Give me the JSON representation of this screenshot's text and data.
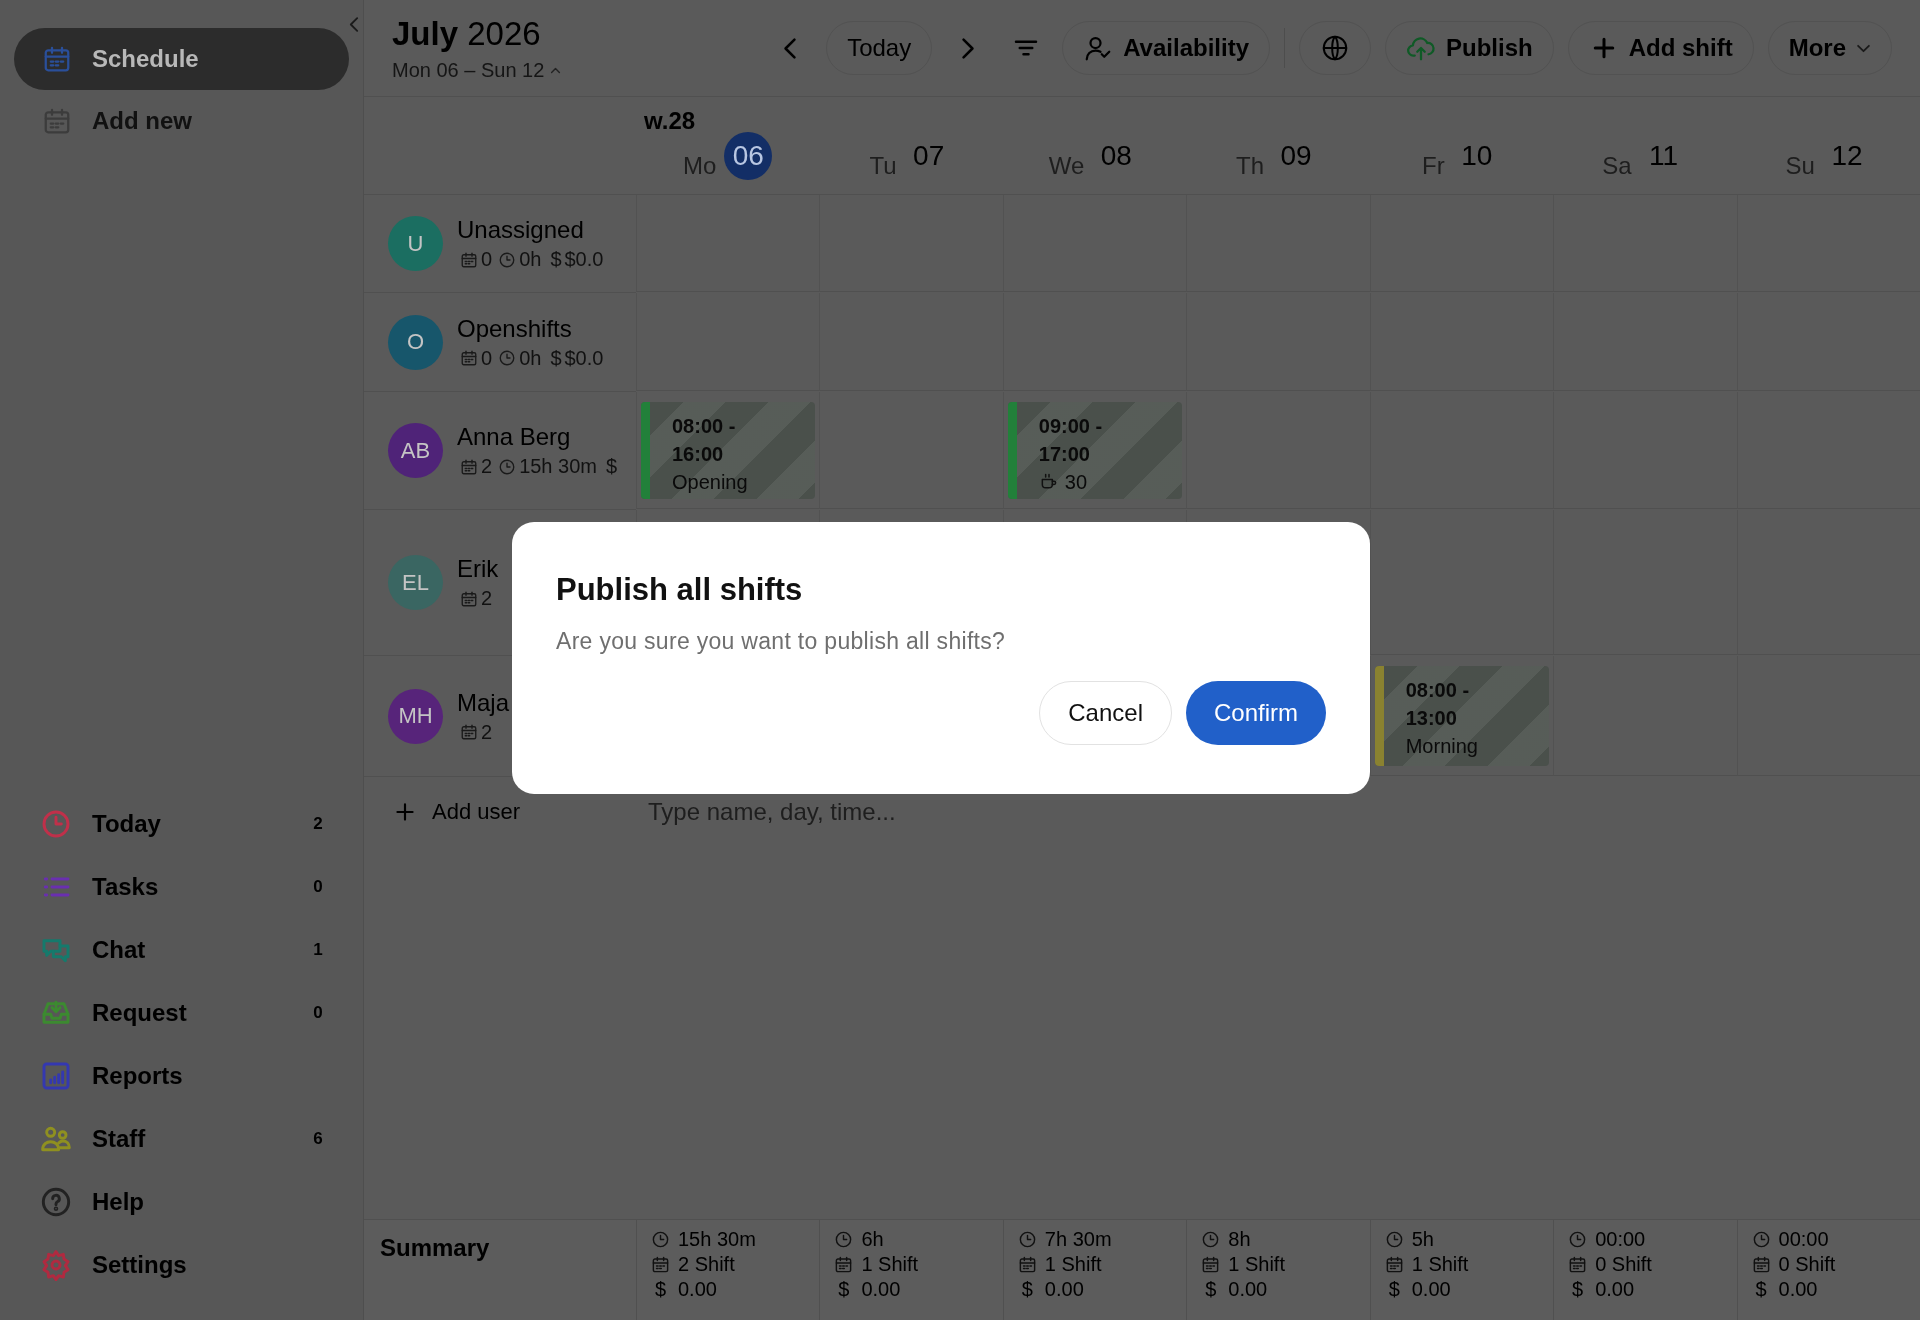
{
  "sidebar": {
    "top_items": [
      {
        "label": "Schedule",
        "selected": true
      },
      {
        "label": "Add new",
        "selected": false
      }
    ],
    "nav_items": [
      {
        "label": "Today",
        "color": "#c0304a",
        "count": "2"
      },
      {
        "label": "Tasks",
        "color": "#6a2fb0",
        "count": "0"
      },
      {
        "label": "Chat",
        "color": "#157a6c",
        "count": "1"
      },
      {
        "label": "Request",
        "color": "#3c8a30",
        "count": "0"
      },
      {
        "label": "Reports",
        "color": "#3438b0"
      },
      {
        "label": "Staff",
        "color": "#8f9020",
        "count": "6"
      },
      {
        "label": "Help",
        "color": "#222222"
      },
      {
        "label": "Settings",
        "color": "#b02a40"
      }
    ]
  },
  "header": {
    "title": "**July** 2026",
    "date_range": "Mon 06 – Sun 12",
    "toolbar": [
      {
        "kind": "prev"
      },
      {
        "kind": "today",
        "label": "Today"
      },
      {
        "kind": "next"
      },
      {
        "kind": "filter"
      },
      {
        "kind": "availability",
        "label": "Availability"
      },
      {
        "kind": "globe"
      },
      {
        "kind": "publish",
        "label": "Publish"
      },
      {
        "kind": "add",
        "label": "Add shift"
      },
      {
        "kind": "more",
        "label": "More"
      }
    ]
  },
  "week_label": "w.28",
  "days": [
    {
      "name": "Mo",
      "date": "06",
      "selected": true
    },
    {
      "name": "Tu",
      "date": "07",
      "selected": false
    },
    {
      "name": "We",
      "date": "08",
      "selected": false
    },
    {
      "name": "Th",
      "date": "09",
      "selected": false
    },
    {
      "name": "Fr",
      "date": "10",
      "selected": false
    },
    {
      "name": "Sa",
      "date": "11",
      "selected": false
    },
    {
      "name": "Su",
      "date": "12",
      "selected": false
    }
  ],
  "rows": [
    {
      "initials": "U",
      "name": "Unassigned",
      "color": "#1b6e61",
      "stats": {
        "shifts": "0",
        "hours": "0h",
        "currency": "$",
        "money": "$0.0"
      }
    },
    {
      "initials": "O",
      "name": "Openshifts",
      "color": "#17566b",
      "stats": {
        "shifts": "0",
        "hours": "0h",
        "currency": "$",
        "money": "$0.0"
      }
    },
    {
      "initials": "AB",
      "name": "Anna Berg",
      "color": "#4f2378",
      "stats": {
        "shifts": "2",
        "hours": "15h 30m",
        "currency": "$"
      },
      "cells": [
        {
          "start": "08:00 -",
          "end": "16:00",
          "note": "Opening",
          "color": "#22803a"
        },
        null,
        {
          "start": "09:00 -",
          "end": "17:00",
          "break_minutes": "30",
          "color": "#22803a"
        },
        null,
        null,
        null,
        null
      ]
    },
    {
      "initials": "EL",
      "name": "Erik",
      "color": "#3a6662",
      "stats": {
        "shifts": "2"
      }
    },
    {
      "initials": "MH",
      "name": "Maja",
      "color": "#57247a",
      "stats": {
        "shifts": "2"
      },
      "cells": [
        null,
        null,
        null,
        null,
        {
          "start": "08:00 -",
          "end": "13:00",
          "note": "Morning",
          "color": "#8a8230"
        },
        null,
        null
      ]
    }
  ],
  "add_user": {
    "label": "Add user",
    "placeholder": "Type name, day, time..."
  },
  "summary": {
    "label": "Summary",
    "columns": [
      {
        "hours": "15h 30m",
        "shifts": "2 Shift",
        "currency": "$",
        "amount": "0.00"
      },
      {
        "hours": "6h",
        "shifts": "1 Shift",
        "currency": "$",
        "amount": "0.00"
      },
      {
        "hours": "7h 30m",
        "shifts": "1 Shift",
        "currency": "$",
        "amount": "0.00"
      },
      {
        "hours": "8h",
        "shifts": "1 Shift",
        "currency": "$",
        "amount": "0.00"
      },
      {
        "hours": "5h",
        "shifts": "1 Shift",
        "currency": "$",
        "amount": "0.00"
      },
      {
        "hours": "00:00",
        "shifts": "0 Shift",
        "currency": "$",
        "amount": "0.00"
      },
      {
        "hours": "00:00",
        "shifts": "0 Shift",
        "currency": "$",
        "amount": "0.00"
      }
    ]
  },
  "dialog": {
    "title": "Publish all shifts",
    "message": "Are you sure you want to publish all shifts?",
    "buttons": [
      {
        "label": "Cancel",
        "kind": "secondary"
      },
      {
        "label": "Confirm",
        "kind": "primary"
      }
    ]
  }
}
